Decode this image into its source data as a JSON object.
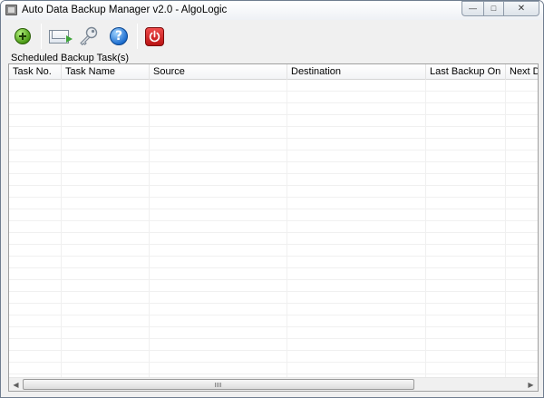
{
  "window": {
    "title": "Auto Data Backup Manager v2.0 - AlgoLogic"
  },
  "titlebar": {
    "app_icon": "window-icon",
    "minimize_glyph": "—",
    "maximize_glyph": "□",
    "close_glyph": "✕"
  },
  "toolbar": {
    "buttons": [
      {
        "name": "add-task-button",
        "icon": "plus-circle-icon"
      },
      {
        "name": "email-settings-button",
        "icon": "envelope-icon"
      },
      {
        "name": "password-button",
        "icon": "key-icon"
      },
      {
        "name": "help-button",
        "icon": "help-circle-icon",
        "glyph": "?"
      },
      {
        "name": "exit-button",
        "icon": "power-icon"
      }
    ]
  },
  "panel": {
    "label": "Scheduled Backup Task(s)"
  },
  "table": {
    "columns": [
      "Task No.",
      "Task Name",
      "Source",
      "Destination",
      "Last Backup On",
      "Next Due"
    ],
    "rows": []
  },
  "scrollbar": {
    "left_arrow": "◀",
    "right_arrow": "▶"
  },
  "colors": {
    "accent_add": "#4b9a16",
    "accent_help": "#1f6fd0",
    "accent_exit": "#c81818"
  }
}
